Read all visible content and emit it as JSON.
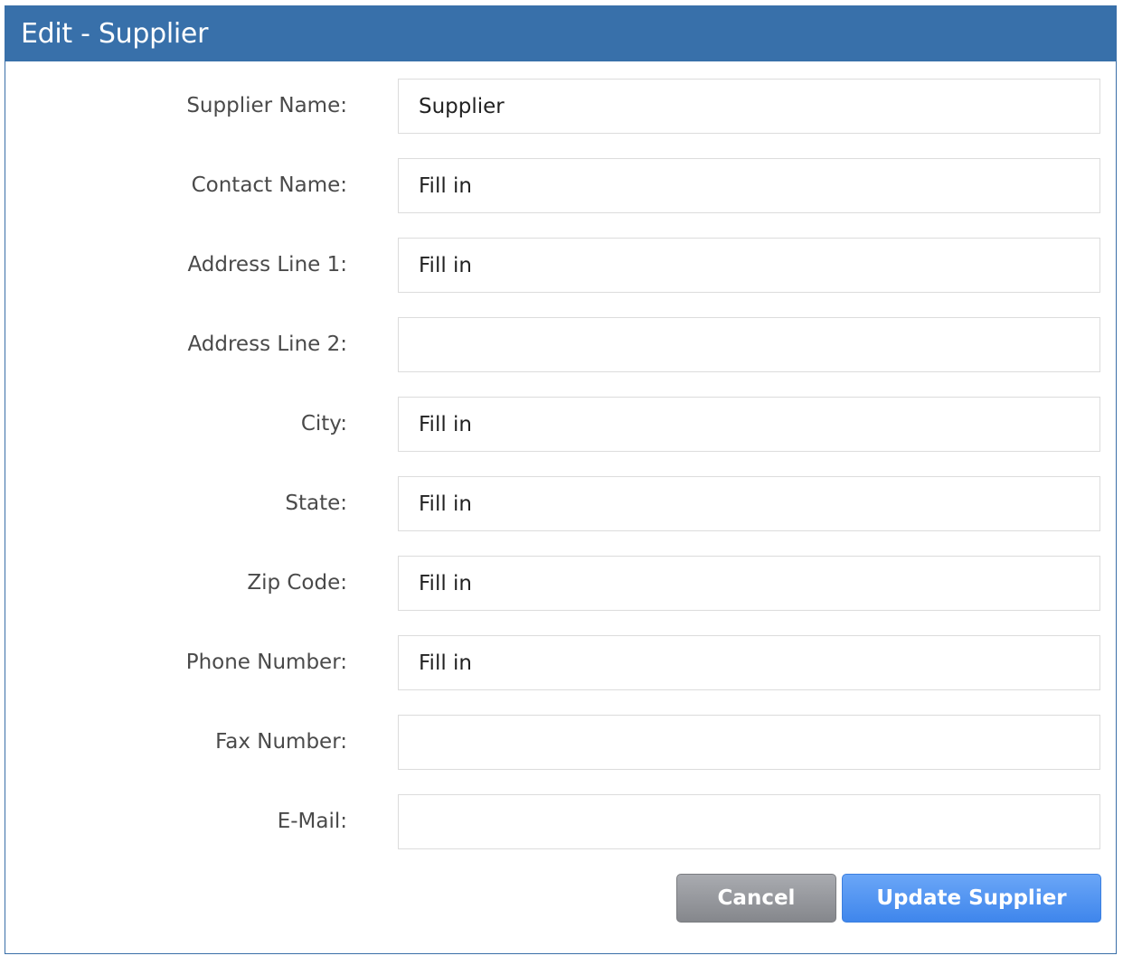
{
  "dialog": {
    "title": "Edit - Supplier"
  },
  "form": {
    "fields": [
      {
        "label": "Supplier Name:",
        "value": "Supplier"
      },
      {
        "label": "Contact Name:",
        "value": "Fill in"
      },
      {
        "label": "Address Line 1:",
        "value": "Fill in"
      },
      {
        "label": "Address Line 2:",
        "value": ""
      },
      {
        "label": "City:",
        "value": "Fill in"
      },
      {
        "label": "State:",
        "value": "Fill in"
      },
      {
        "label": "Zip Code:",
        "value": "Fill in"
      },
      {
        "label": "Phone Number:",
        "value": "Fill in"
      },
      {
        "label": "Fax Number:",
        "value": ""
      },
      {
        "label": "E-Mail:",
        "value": ""
      }
    ]
  },
  "actions": {
    "cancel_label": "Cancel",
    "update_label": "Update Supplier"
  },
  "colors": {
    "titlebar": "#3870aa",
    "primary_button": "#4a8ff0",
    "secondary_button": "#95979c"
  }
}
